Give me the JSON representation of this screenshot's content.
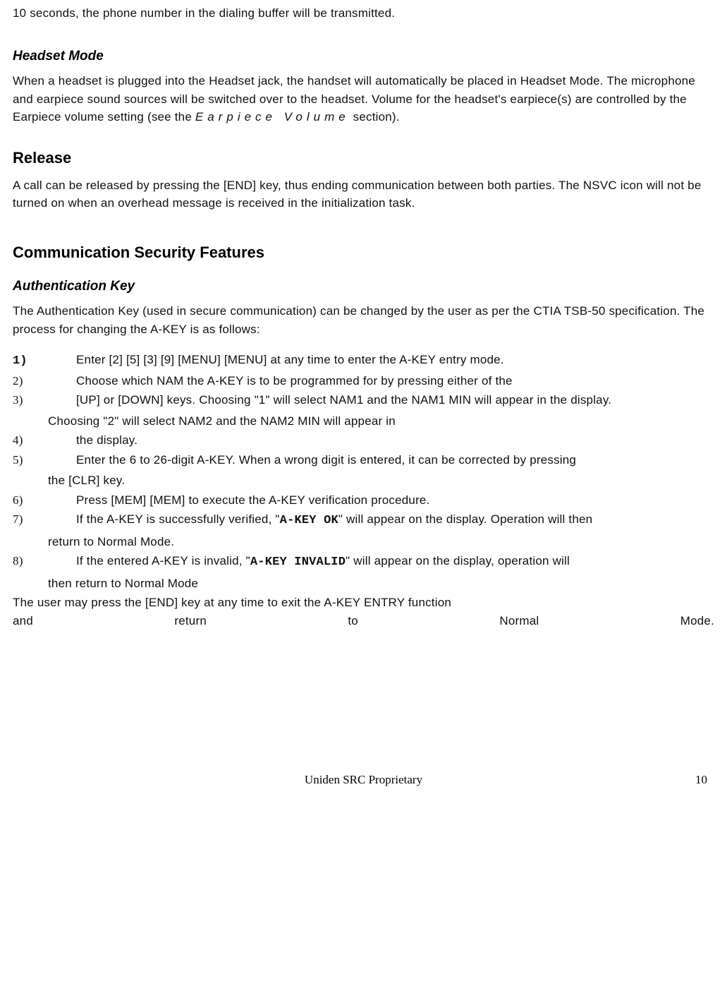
{
  "intro_line": "10 seconds, the phone number in the dialing buffer will be transmitted.",
  "headset": {
    "title": "Headset Mode",
    "para_a": "When a headset is plugged into the Headset jack, the handset will automatically be placed in Headset Mode. The microphone and earpiece sound sources will be switched over to the headset. Volume for the headset's earpiece(s) are controlled by the Earpiece volume setting (see the ",
    "em": "Earpiece Volume",
    "para_b": " section)."
  },
  "release": {
    "title": "Release",
    "para": "A call can be released by pressing the [END] key, thus ending communication between both parties. The NSVC icon will not be turned on when an overhead message is received in the initialization task."
  },
  "csf": {
    "title": "Communication Security Features"
  },
  "auth": {
    "title": "Authentication Key",
    "intro": "The Authentication Key (used in secure communication) can be changed by the user as per the CTIA TSB-50 specification. The process for changing the A-KEY is as follows:",
    "steps": {
      "s1": "Enter [2] [5] [3] [9] [MENU] [MENU] at any time to enter the A-KEY entry mode.",
      "s2": "Choose which NAM the A-KEY is to be programmed for by pressing either of the",
      "s3": "[UP] or [DOWN] keys. Choosing \"1\" will select NAM1 and the NAM1 MIN will appear in the display.",
      "s3b": "Choosing \"2\" will select NAM2 and the NAM2 MIN will appear in",
      "s4": "the display.",
      "s5": "Enter the 6 to 26-digit A-KEY.  When a wrong digit is entered, it can be corrected by pressing",
      "s5b": "the [CLR] key.",
      "s6": "Press [MEM] [MEM] to execute the A-KEY verification procedure.",
      "s7a": "If the A-KEY is successfully verified, \"",
      "s7ok": "A-KEY OK",
      "s7b": "\" will appear on the display. Operation will then",
      "s7c": "return to Normal Mode.",
      "s8a": "If the entered A-KEY is invalid, \"",
      "s8inv": "A-KEY INVALID",
      "s8b": "\" will appear on the display, operation will",
      "s8c": "then return to Normal Mode"
    },
    "tail1": "The user may press the [END] key at any time to exit the A-KEY ENTRY function",
    "tail2_words": [
      "and",
      "return",
      "to",
      "Normal",
      "Mode."
    ]
  },
  "footer": {
    "center": "Uniden SRC Proprietary",
    "page": "10"
  }
}
